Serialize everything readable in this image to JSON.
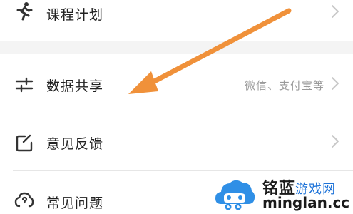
{
  "settings": {
    "items": [
      {
        "label": "课程计划",
        "icon": "running-person-icon"
      },
      {
        "label": "数据共享",
        "value": "微信、支付宝等",
        "icon": "sliders-icon"
      },
      {
        "label": "意见反馈",
        "icon": "edit-square-icon"
      },
      {
        "label": "常见问题",
        "icon": "help-cloud-icon"
      }
    ]
  },
  "annotation": {
    "arrow_color": "#f0913a"
  },
  "watermark": {
    "title": "铭蓝",
    "title_accent": "游戏网",
    "url": "minglan.cc"
  }
}
